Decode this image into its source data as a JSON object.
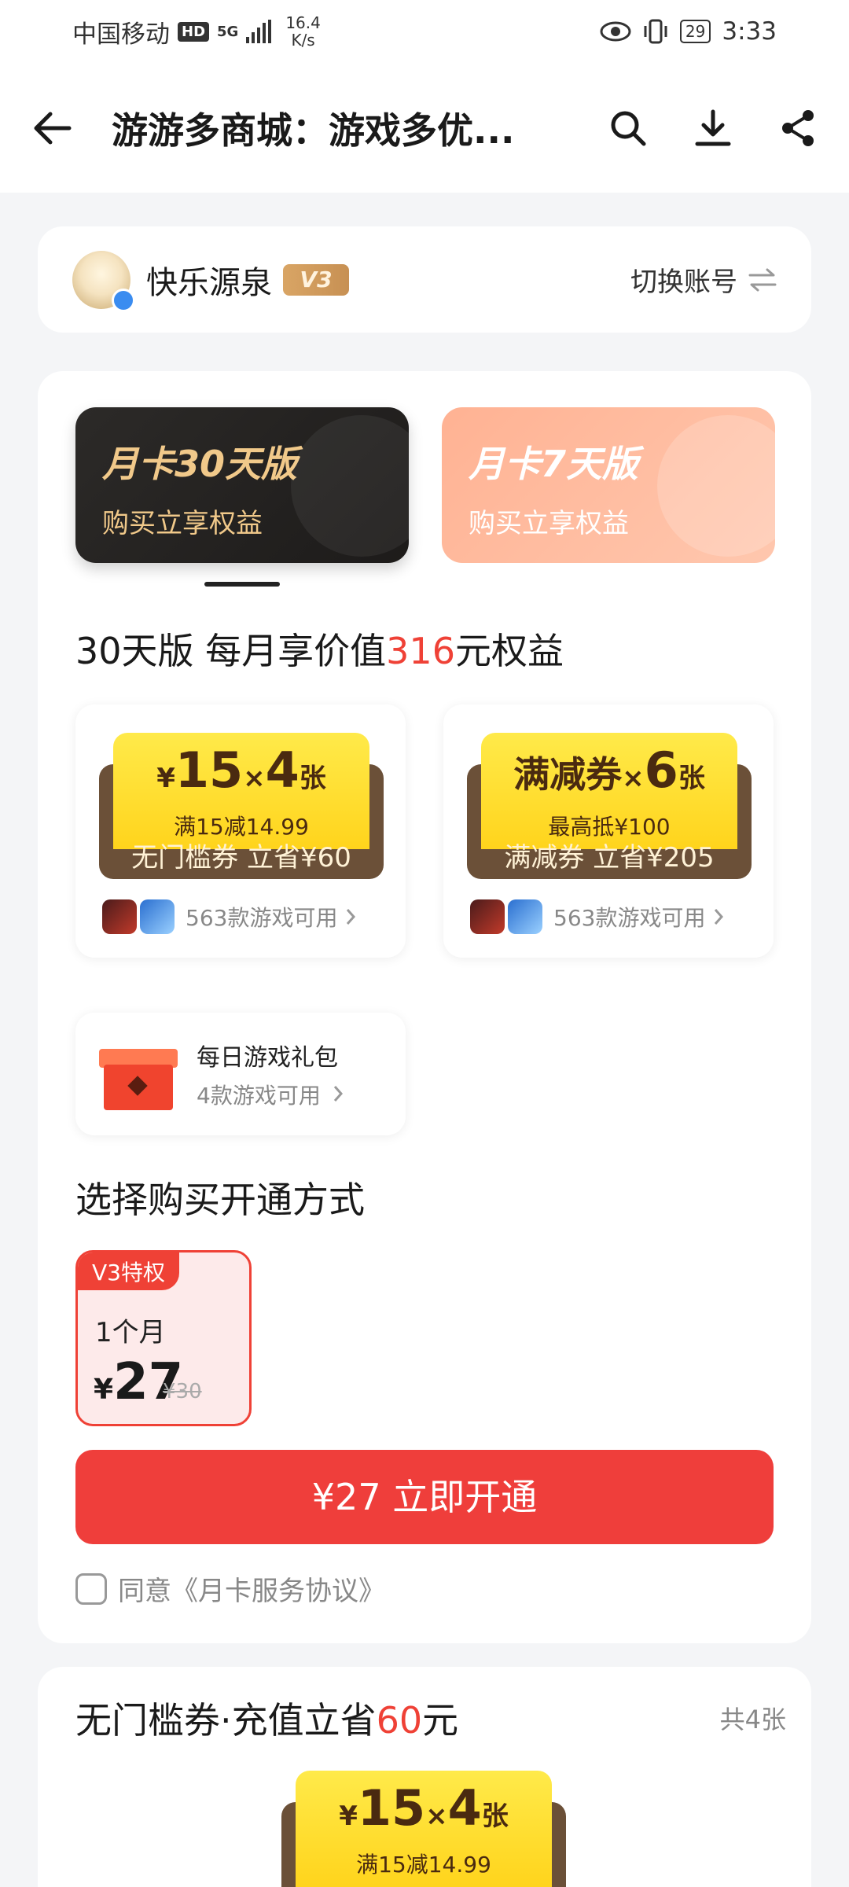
{
  "status_bar": {
    "carrier": "中国移动",
    "hd": "HD",
    "net": "5G",
    "speed_value": "16.4",
    "speed_unit": "K/s",
    "battery": "29",
    "time": "3:33"
  },
  "nav": {
    "title": "游游多商城：游戏多优..."
  },
  "account": {
    "name": "快乐源泉",
    "level": "V3",
    "switch_label": "切换账号"
  },
  "plans": [
    {
      "title": "月卡30天版",
      "subtitle": "购买立享权益"
    },
    {
      "title": "月卡7天版",
      "subtitle": "购买立享权益"
    }
  ],
  "benefit": {
    "prefix": "30天版 每月享价值",
    "amount": "316",
    "suffix": "元权益"
  },
  "coupons": [
    {
      "main_prefix": "¥",
      "main_value": "15",
      "times": "×",
      "count": "4",
      "unit": "张",
      "condition": "满15减14.99",
      "footer": "无门槛券 立省¥60",
      "games_text": "563款游戏可用"
    },
    {
      "main_prefix": "",
      "main_value": "满减券",
      "times": "×",
      "count": "6",
      "unit": "张",
      "condition": "最高抵¥100",
      "footer": "满减券 立省¥205",
      "games_text": "563款游戏可用"
    }
  ],
  "gift": {
    "title": "每日游戏礼包",
    "subtitle": "4款游戏可用"
  },
  "purchase": {
    "section_title": "选择购买开通方式",
    "tag": "V3特权",
    "term": "1个月",
    "currency": "¥",
    "price": "27",
    "original_price": "¥30",
    "button_label": "¥27 立即开通",
    "agree_text": "同意《月卡服务协议》"
  },
  "section2": {
    "title_prefix": "无门槛券·充值立省",
    "amount": "60",
    "title_suffix": "元",
    "count_label": "共4张",
    "coupon": {
      "main_prefix": "¥",
      "main_value": "15",
      "times": "×",
      "count": "4",
      "unit": "张",
      "condition": "满15减14.99"
    }
  },
  "colors": {
    "accent_red": "#ef4136",
    "coupon_yellow": "#ffd41c",
    "coupon_brown": "#6b5038",
    "vip_gold": "#d9a565"
  }
}
